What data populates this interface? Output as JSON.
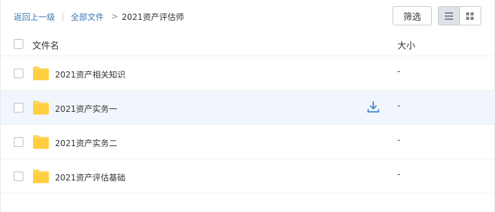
{
  "breadcrumb": {
    "back_label": "返回上一级",
    "root_label": "全部文件",
    "current_label": "2021资产评估师"
  },
  "toolbar": {
    "filter_label": "筛选",
    "view_modes": [
      "list-view-icon",
      "grid-view-icon"
    ],
    "active_view": "list"
  },
  "table": {
    "headers": {
      "name": "文件名",
      "size": "大小"
    },
    "rows": [
      {
        "name": "2021资产相关知识",
        "size": "-",
        "icon": "folder-icon"
      },
      {
        "name": "2021资产实务一",
        "size": "-",
        "icon": "folder-icon",
        "hovered": true
      },
      {
        "name": "2021资产实务二",
        "size": "-",
        "icon": "folder-icon"
      },
      {
        "name": "2021资产评估基础",
        "size": "-",
        "icon": "folder-icon"
      }
    ]
  },
  "colors": {
    "link": "#3c76b3",
    "folder": "#ffd65c",
    "hover_row": "#f1f6fd",
    "download_icon": "#4d8fd0"
  }
}
